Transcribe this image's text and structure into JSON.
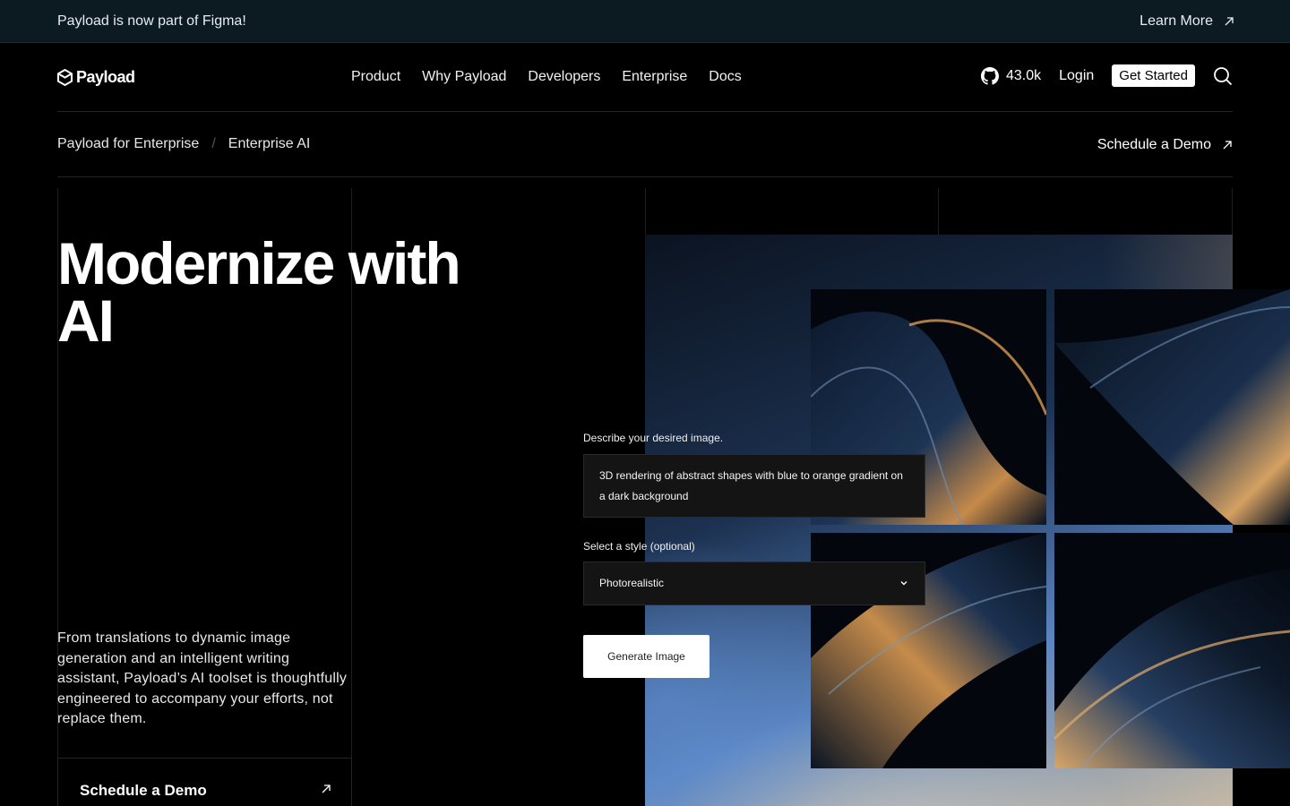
{
  "banner": {
    "text": "Payload is now part of Figma!",
    "link": "Learn More"
  },
  "nav": {
    "logo": "Payload",
    "links": [
      "Product",
      "Why Payload",
      "Developers",
      "Enterprise",
      "Docs"
    ],
    "stars": "43.0k",
    "login": "Login",
    "cta": "Get Started"
  },
  "breadcrumb": {
    "items": [
      "Payload for Enterprise",
      "Enterprise AI"
    ],
    "separator": "/"
  },
  "subnav_cta": "Schedule a Demo",
  "hero": {
    "title": "Modernize with AI",
    "description": "From translations to dynamic image generation and an intelligent writing assistant, Payload’s AI toolset is thoughtfully engineered to accompany your efforts, not replace them.",
    "demo_button": "Schedule a Demo"
  },
  "form": {
    "prompt_label": "Describe your desired image.",
    "prompt_value": "3D rendering of abstract shapes with blue to orange  gradient on a dark background",
    "style_label": "Select a style (optional)",
    "style_value": "Photorealistic",
    "generate_button": "Generate Image"
  },
  "icons": {
    "external": "arrow-up-right-icon",
    "github": "github-icon",
    "search": "search-icon",
    "chevron": "chevron-down-icon"
  }
}
